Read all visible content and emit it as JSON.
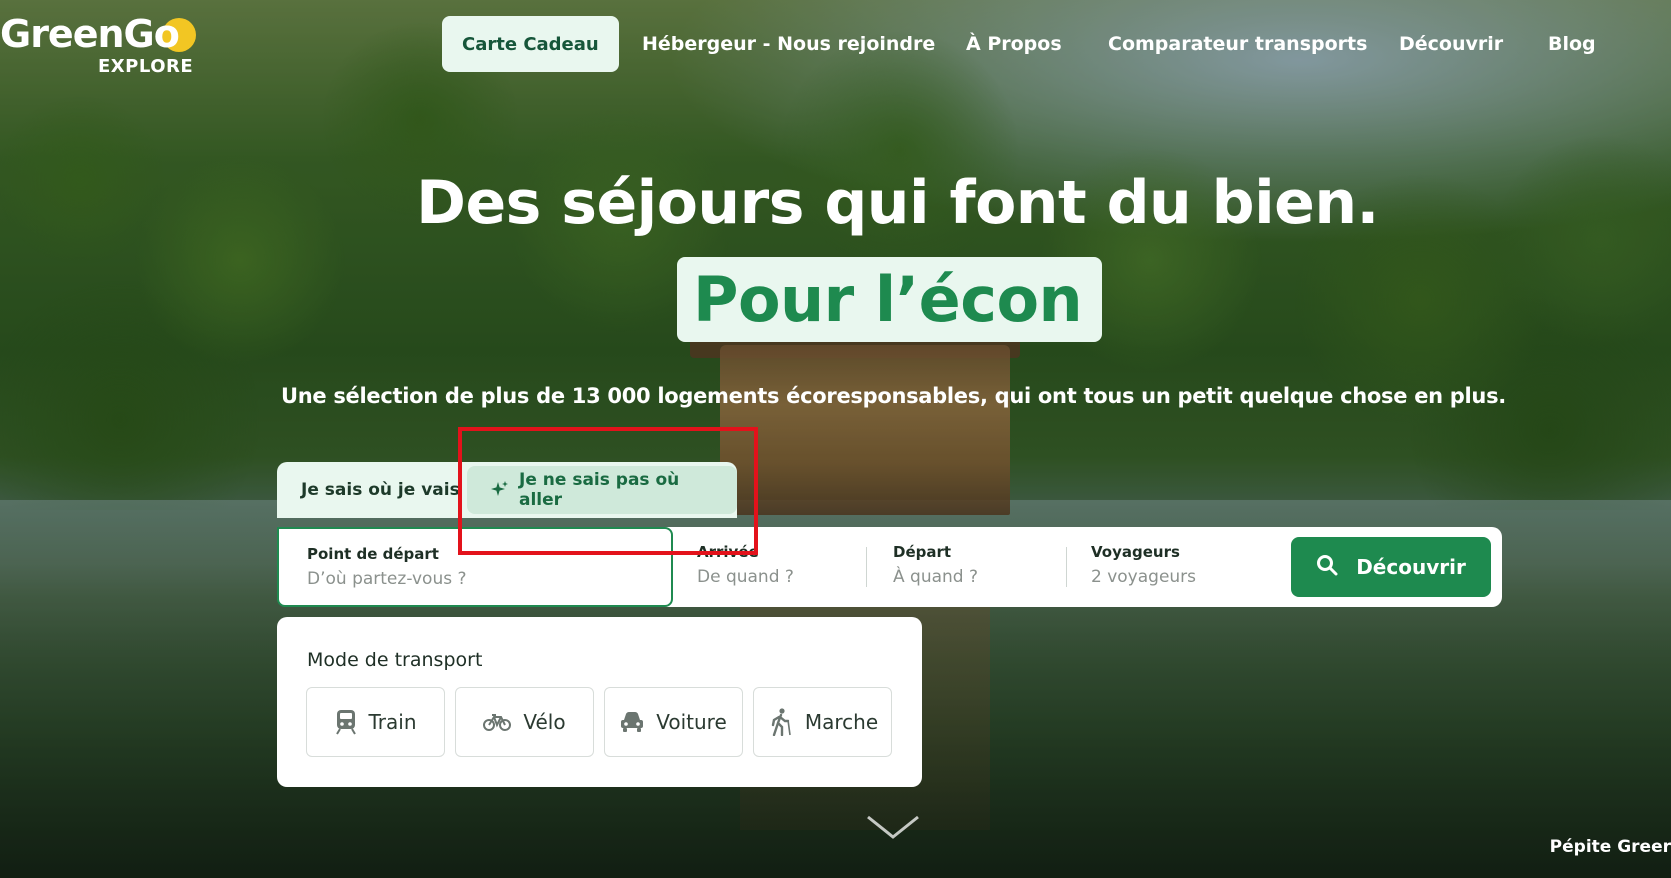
{
  "header": {
    "logo_main": "GreenGo",
    "logo_sub": "EXPLORE",
    "gift_card": "Carte Cadeau",
    "nav": [
      "Hébergeur - Nous rejoindre",
      "À Propos",
      "Comparateur transports",
      "Découvrir",
      "Blog"
    ]
  },
  "hero": {
    "title": "Des séjours qui font du bien.",
    "pill": "Pour l’écon",
    "subtitle": "Une sélection de plus de 13 000 logements écoresponsables, qui ont tous un petit quelque chose en plus."
  },
  "tabs": {
    "know": "Je sais où je vais",
    "dunno": "Je ne sais pas où aller"
  },
  "search": {
    "start_label": "Point de départ",
    "start_placeholder": "D’où partez-vous ?",
    "arrival_label": "Arrivée",
    "arrival_placeholder": "De quand ?",
    "departure_label": "Départ",
    "departure_placeholder": "À quand ?",
    "travelers_label": "Voyageurs",
    "travelers_value": "2 voyageurs",
    "button": "Découvrir"
  },
  "transport": {
    "title": "Mode de transport",
    "modes": [
      "Train",
      "Vélo",
      "Voiture",
      "Marche"
    ]
  },
  "footer": {
    "credit": "Pépite Greer"
  },
  "colors": {
    "brand_green": "#1e8a4f",
    "mint": "#e9f7ef",
    "sun": "#f2c623",
    "highlight": "#e3121b"
  }
}
